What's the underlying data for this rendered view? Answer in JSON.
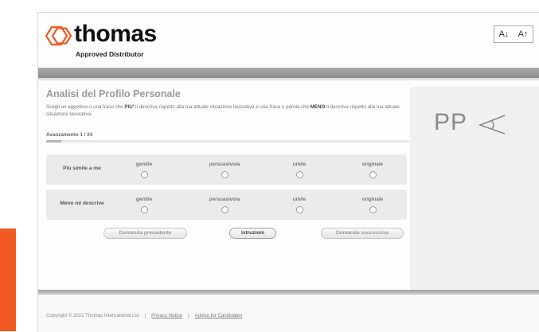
{
  "brand": {
    "name": "thomas",
    "tagline": "Approved Distributor",
    "accent_color": "#f05a22"
  },
  "font_controls": {
    "decrease": "A↓",
    "increase": "A↑"
  },
  "assessment": {
    "title": "Analisi del Profilo Personale",
    "instructions_pre": "Scegli un aggettivo o una frase che ",
    "instructions_bold1": "PIU'",
    "instructions_mid": " ti descriva rispetto alla tua attuale situazione lavorativa e una frase o parola che ",
    "instructions_bold2": "MENO",
    "instructions_post": " ti descriva rispetto alla tua attuale situazione lavorativa.",
    "progress_label": "Avanzamento 1 / 24",
    "progress_fraction": 0.0417,
    "rows": [
      {
        "label": "Più simile a me",
        "options": [
          "gentile",
          "persuasivo/a",
          "umile",
          "originale"
        ]
      },
      {
        "label": "Meno mi descrive",
        "options": [
          "gentile",
          "persuasivo/a",
          "umile",
          "originale"
        ]
      }
    ],
    "buttons": {
      "previous": "Domanda precedente",
      "instructions": "Istruzioni",
      "next": "Domanda successiva"
    }
  },
  "side_logo": "PP",
  "footer": {
    "copyright": "Copyright © 2021 Thomas International Ltd",
    "privacy": "Privacy Notice",
    "advice": "Advice for Candidates"
  }
}
